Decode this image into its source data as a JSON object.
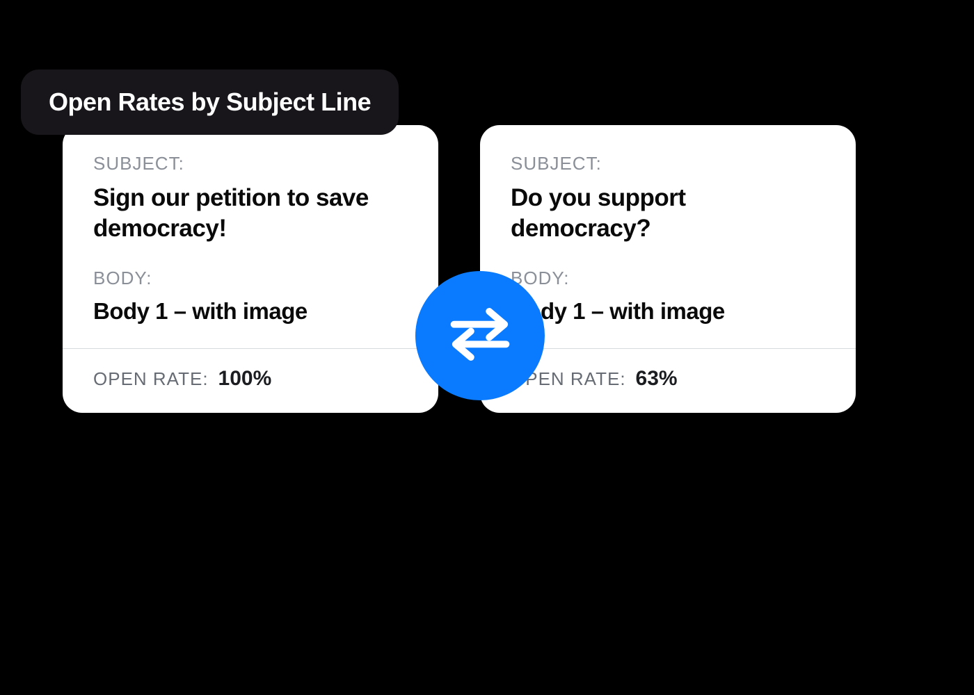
{
  "header": {
    "title": "Open Rates by Subject Line"
  },
  "labels": {
    "subject": "SUBJECT:",
    "body": "BODY:",
    "open_rate": "OPEN RATE:"
  },
  "swap_icon": "swap-horizontal-icon",
  "cards": [
    {
      "subject": "Sign our petition to save democracy!",
      "body": "Body 1 – with image",
      "open_rate": "100%"
    },
    {
      "subject": "Do you support democracy?",
      "body": "Body 1 – with image",
      "open_rate": "63%"
    }
  ],
  "colors": {
    "accent_blue": "#0a7bff",
    "pill_bg": "#18161a",
    "card_bg": "#ffffff",
    "page_bg": "#000000"
  }
}
